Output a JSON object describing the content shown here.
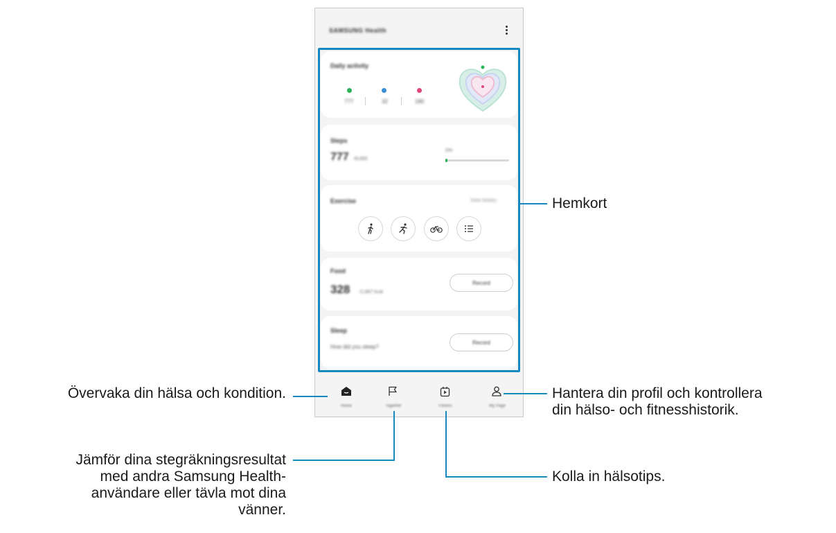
{
  "callouts": {
    "home_cards": "Hemkort",
    "home_tab": "Övervaka din hälsa och kondition.",
    "together_tab": [
      "Jämför dina stegräkningsresultat",
      "med andra Samsung Health-",
      "användare eller tävla mot dina",
      "vänner."
    ],
    "fitness_tab": "Kolla in hälsotips.",
    "profile_tab": [
      "Hantera din profil och kontrollera",
      "din hälso- och fitnesshistorik."
    ]
  },
  "app": {
    "title": "SAMSUNG Health",
    "daily": {
      "title": "Daily activity",
      "stats": [
        "777",
        "32",
        "180"
      ]
    },
    "steps": {
      "title": "Steps",
      "value": "777",
      "goal": "/6,000",
      "percent_label": "0%",
      "progress": 0.03
    },
    "exercise": {
      "title": "Exercise",
      "link": "View history"
    },
    "food": {
      "title": "Food",
      "value": "328",
      "unit": "/1,667 kcal",
      "button": "Record"
    },
    "sleep": {
      "title": "Sleep",
      "question": "How did you sleep?",
      "button": "Record"
    },
    "nav": [
      "Home",
      "Together",
      "Fitness",
      "My Page"
    ]
  },
  "colors": {
    "accent": "#1588c1",
    "steps_green": "#2bb15a",
    "active_blue": "#3b8fd6",
    "calorie_pink": "#e0457b"
  },
  "icons": [
    "more-vertical-icon",
    "walk-icon",
    "run-icon",
    "bike-icon",
    "list-icon",
    "home-icon",
    "flag-icon",
    "play-calendar-icon",
    "person-icon"
  ]
}
